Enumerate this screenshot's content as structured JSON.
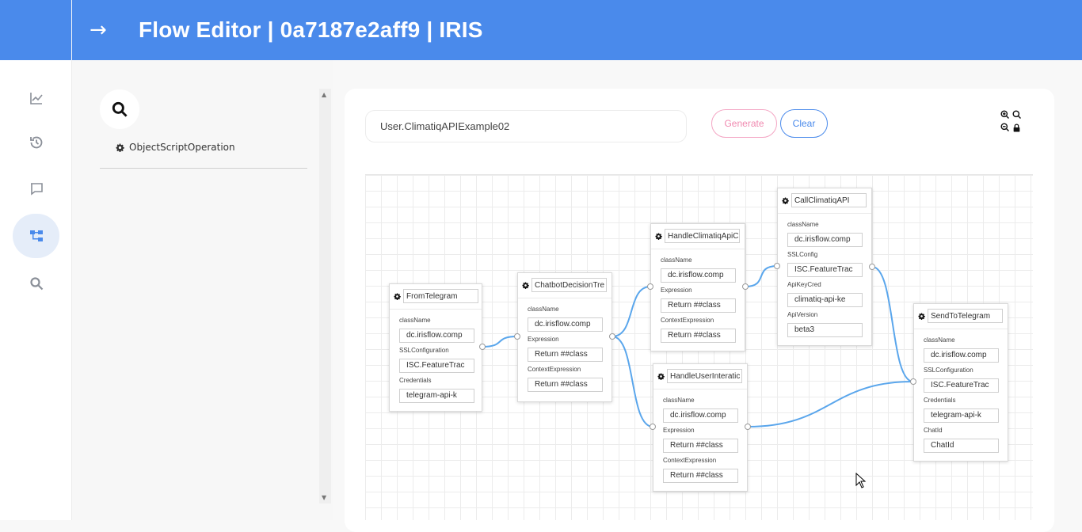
{
  "header": {
    "title": "Flow Editor | 0a7187e2aff9 | IRIS",
    "back_icon": "arrow-right-icon"
  },
  "sidebar": {
    "items": [
      {
        "name": "chart",
        "icon": "chart-line-icon",
        "active": false
      },
      {
        "name": "history",
        "icon": "history-icon",
        "active": false
      },
      {
        "name": "chat",
        "icon": "chat-icon",
        "active": false
      },
      {
        "name": "flow",
        "icon": "flow-icon",
        "active": true
      },
      {
        "name": "search",
        "icon": "search-icon",
        "active": false
      }
    ]
  },
  "palette": {
    "items": [
      {
        "label": "ObjectScriptOperation",
        "icon": "gear-icon"
      }
    ]
  },
  "toolbar": {
    "flow_name": "User.ClimatiqAPIExample02",
    "generate_label": "Generate",
    "clear_label": "Clear"
  },
  "colors": {
    "accent": "#4a8aeb",
    "link": "#5aa6ec",
    "generate": "#f08ab0"
  },
  "nodes": [
    {
      "id": "n1",
      "name": "FromTelegram",
      "fields": [
        {
          "label": "className",
          "value": "dc.irisflow.comp"
        },
        {
          "label": "SSLConfiguration",
          "value": "ISC.FeatureTrac"
        },
        {
          "label": "Credentials",
          "value": "telegram-api-k"
        }
      ]
    },
    {
      "id": "n2",
      "name": "ChatbotDecisionTre",
      "fields": [
        {
          "label": "className",
          "value": "dc.irisflow.comp"
        },
        {
          "label": "Expression",
          "value": "Return ##class"
        },
        {
          "label": "ContextExpression",
          "value": "Return ##class"
        }
      ]
    },
    {
      "id": "n3",
      "name": "HandleClimatiqApiC",
      "fields": [
        {
          "label": "className",
          "value": "dc.irisflow.comp"
        },
        {
          "label": "Expression",
          "value": "Return ##class"
        },
        {
          "label": "ContextExpression",
          "value": "Return ##class"
        }
      ]
    },
    {
      "id": "n4",
      "name": "CallClimatiqAPI",
      "fields": [
        {
          "label": "className",
          "value": "dc.irisflow.comp"
        },
        {
          "label": "SSLConfig",
          "value": "ISC.FeatureTrac"
        },
        {
          "label": "ApiKeyCred",
          "value": "climatiq-api-ke"
        },
        {
          "label": "ApiVersion",
          "value": "beta3"
        }
      ]
    },
    {
      "id": "n5",
      "name": "HandleUserInteratic",
      "fields": [
        {
          "label": "className",
          "value": "dc.irisflow.comp"
        },
        {
          "label": "Expression",
          "value": "Return ##class"
        },
        {
          "label": "ContextExpression",
          "value": "Return ##class"
        }
      ]
    },
    {
      "id": "n6",
      "name": "SendToTelegram",
      "fields": [
        {
          "label": "className",
          "value": "dc.irisflow.comp"
        },
        {
          "label": "SSLConfiguration",
          "value": "ISC.FeatureTrac"
        },
        {
          "label": "Credentials",
          "value": "telegram-api-k"
        },
        {
          "label": "ChatId",
          "value": "ChatId"
        }
      ]
    }
  ],
  "links": [
    {
      "from": "n1",
      "to": "n2"
    },
    {
      "from": "n2",
      "to": "n3"
    },
    {
      "from": "n2",
      "to": "n5"
    },
    {
      "from": "n3",
      "to": "n4"
    },
    {
      "from": "n4",
      "to": "n6"
    },
    {
      "from": "n5",
      "to": "n6"
    }
  ]
}
